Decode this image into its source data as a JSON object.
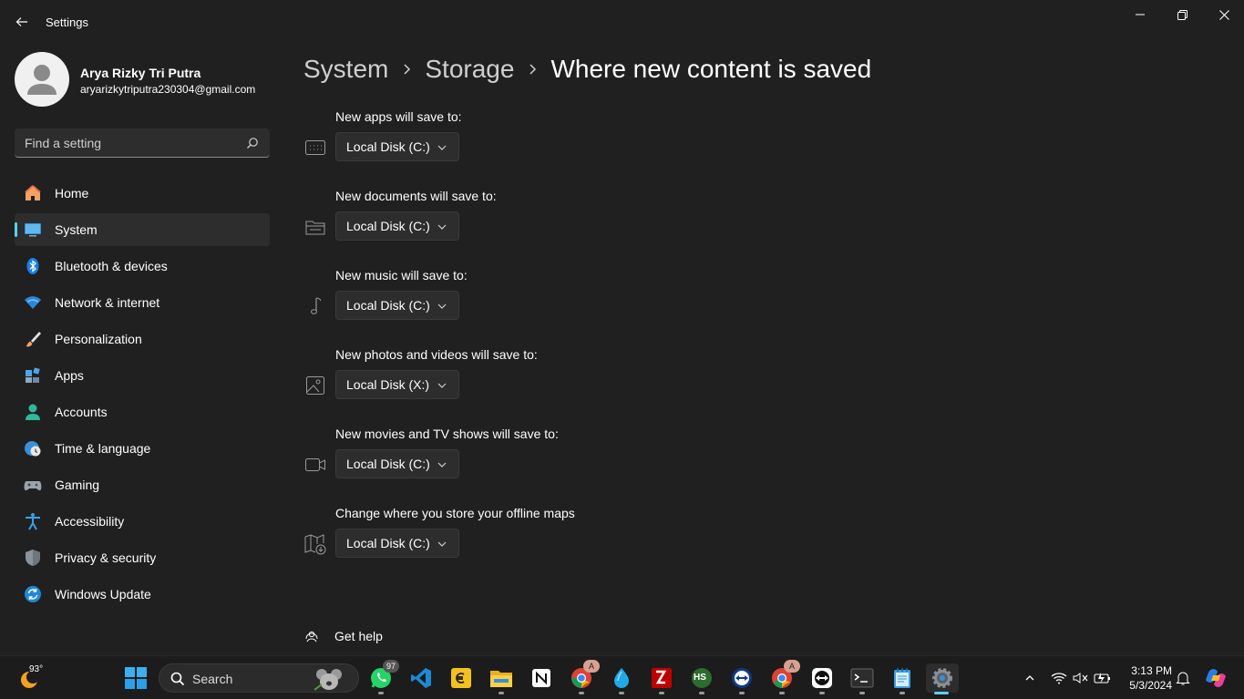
{
  "window": {
    "title": "Settings",
    "controls": [
      "minimize",
      "maximize",
      "close"
    ]
  },
  "profile": {
    "name": "Arya Rizky Tri Putra",
    "email": "aryarizkytriputra230304@gmail.com"
  },
  "search": {
    "placeholder": "Find a setting"
  },
  "nav": {
    "items": [
      {
        "label": "Home",
        "icon": "home-icon"
      },
      {
        "label": "System",
        "icon": "system-icon",
        "active": true
      },
      {
        "label": "Bluetooth & devices",
        "icon": "bluetooth-icon"
      },
      {
        "label": "Network & internet",
        "icon": "wifi-icon"
      },
      {
        "label": "Personalization",
        "icon": "brush-icon"
      },
      {
        "label": "Apps",
        "icon": "apps-icon"
      },
      {
        "label": "Accounts",
        "icon": "account-icon"
      },
      {
        "label": "Time & language",
        "icon": "clock-globe-icon"
      },
      {
        "label": "Gaming",
        "icon": "gamepad-icon"
      },
      {
        "label": "Accessibility",
        "icon": "accessibility-icon"
      },
      {
        "label": "Privacy & security",
        "icon": "shield-icon"
      },
      {
        "label": "Windows Update",
        "icon": "update-icon"
      }
    ]
  },
  "breadcrumb": {
    "items": [
      "System",
      "Storage"
    ],
    "current": "Where new content is saved"
  },
  "save_locations": [
    {
      "label": "New apps will save to:",
      "value": "Local Disk (C:)",
      "icon": "apps-drive-icon"
    },
    {
      "label": "New documents will save to:",
      "value": "Local Disk (C:)",
      "icon": "folder-icon"
    },
    {
      "label": "New music will save to:",
      "value": "Local Disk (C:)",
      "icon": "music-note-icon"
    },
    {
      "label": "New photos and videos will save to:",
      "value": "Local Disk (X:)",
      "icon": "image-icon"
    },
    {
      "label": "New movies and TV shows will save to:",
      "value": "Local Disk (C:)",
      "icon": "video-camera-icon"
    },
    {
      "label": "Change where you store your offline maps",
      "value": "Local Disk (C:)",
      "icon": "map-download-icon"
    }
  ],
  "help": {
    "label": "Get help"
  },
  "taskbar": {
    "weather_temp": "93°",
    "search_label": "Search",
    "whatsapp_badge": "97",
    "chrome_badge": "A",
    "chrome2_badge": "A",
    "hs_label": "HS",
    "notion_label": "N",
    "clock_time": "3:13 PM",
    "clock_date": "5/3/2024"
  },
  "colors": {
    "background": "#202020",
    "accent": "#60cdff",
    "control": "#2d2d2d",
    "taskbar": "#1c1c1c"
  }
}
